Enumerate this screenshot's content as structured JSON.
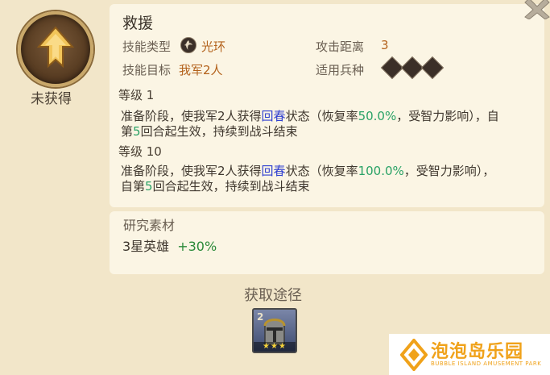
{
  "skill": {
    "status": "未获得",
    "name": "救援",
    "type_label": "技能类型",
    "type_value": "光环",
    "target_label": "技能目标",
    "target_value": "我军2人",
    "range_label": "攻击距离",
    "range_value": "3",
    "units_label": "适用兵种",
    "unit_icons": [
      "sword-unit-icon",
      "shield-unit-icon",
      "bow-unit-icon"
    ]
  },
  "levels": [
    {
      "label": "等级 1",
      "desc_a": "准备阶段，使我军2人获得",
      "keyword": "回春",
      "desc_b": "状态（恢复率",
      "rate": "50.0%",
      "desc_c": "，受智力影响），自",
      "desc_d": "第",
      "turn": "5",
      "desc_e": "回合起生效，持续到战斗结束"
    },
    {
      "label": "等级 10",
      "desc_a": "准备阶段，使我军2人获得",
      "keyword": "回春",
      "desc_b": "状态（恢复率",
      "rate": "100.0%",
      "desc_c": "，受智力影响），",
      "desc_d": "自第",
      "turn": "5",
      "desc_e": "回合起生效，持续到战斗结束"
    }
  ],
  "research": {
    "title": "研究素材",
    "item": "3星英雄",
    "bonus": "+30%"
  },
  "obtain": {
    "title": "获取途径",
    "hero_stars": "★★★",
    "hero_num": "2"
  },
  "watermark": {
    "title": "泡泡岛乐园",
    "subtitle": "BUBBLE ISLAND AMUSEMENT PARK"
  },
  "colors": {
    "accent_orange": "#b3621c",
    "keyword_blue": "#2f3fd0",
    "value_green": "#2aa266",
    "watermark_orange": "#f0a21a"
  }
}
